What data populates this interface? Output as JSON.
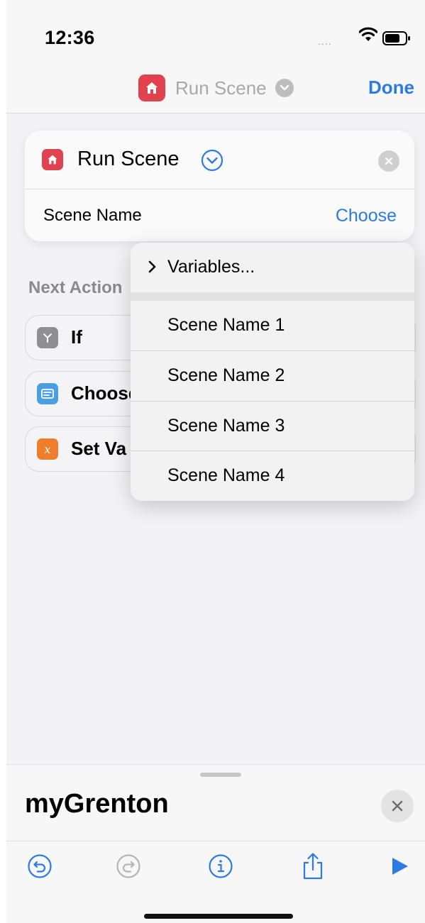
{
  "status_bar": {
    "time": "12:36",
    "signal": "....",
    "icons": [
      "wifi-icon",
      "battery-icon"
    ]
  },
  "nav": {
    "title": "Run Scene",
    "done_label": "Done",
    "icons": [
      "home-icon",
      "chevron-down-icon"
    ]
  },
  "action": {
    "title": "Run Scene",
    "param_label": "Scene Name",
    "param_value": "Choose",
    "icons": [
      "home-icon",
      "chevron-down-circle-icon",
      "close-circle-icon"
    ]
  },
  "next_actions": {
    "header": "Next Action",
    "items": [
      {
        "label": "If",
        "icon": "branch-icon",
        "color": "#8e8e93"
      },
      {
        "label": "Choose",
        "icon": "menu-icon",
        "color": "#4a9fe0"
      },
      {
        "label": "Set Va",
        "icon": "variable-x-icon",
        "color": "#ee7e2a"
      }
    ]
  },
  "menu": {
    "variables_label": "Variables...",
    "items": [
      "Scene Name 1",
      "Scene Name 2",
      "Scene Name 3",
      "Scene Name 4"
    ]
  },
  "sheet": {
    "title": "myGrenton",
    "toolbar": [
      "undo-icon",
      "redo-icon",
      "info-icon",
      "share-icon",
      "play-icon"
    ]
  },
  "colors": {
    "accent": "#2c7be5",
    "home_app": "#e0424f",
    "background": "#f2f2f7"
  }
}
